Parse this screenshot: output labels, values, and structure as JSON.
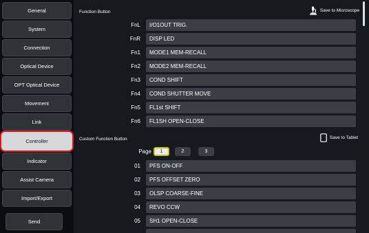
{
  "sidebar": {
    "items": [
      {
        "label": "General"
      },
      {
        "label": "System"
      },
      {
        "label": "Connection"
      },
      {
        "label": "Optical Device"
      },
      {
        "label": "OPT Optical Device"
      },
      {
        "label": "Movement"
      },
      {
        "label": "Link"
      },
      {
        "label": "Controller",
        "selected": true
      },
      {
        "label": "Indicator"
      },
      {
        "label": "Assist Camera"
      },
      {
        "label": "Import/Export"
      }
    ],
    "send_label": "Send"
  },
  "function_button": {
    "title": "Function Button",
    "save_label": "Save to Microscope",
    "save_icon": "microscope-icon",
    "rows": [
      {
        "key": "FnL",
        "value": "I/O1OUT TRIG."
      },
      {
        "key": "FnR",
        "value": "DISP LED"
      },
      {
        "key": "Fn1",
        "value": "MODE1 MEM-RECALL"
      },
      {
        "key": "Fn2",
        "value": "MODE2 MEM-RECALL"
      },
      {
        "key": "Fn3",
        "value": "COND SHIFT"
      },
      {
        "key": "Fn4",
        "value": "COND SHUTTER MOVE"
      },
      {
        "key": "Fn5",
        "value": "FL1st SHIFT"
      },
      {
        "key": "Fn6",
        "value": "FL1SH OPEN-CLOSE"
      }
    ]
  },
  "custom_function_button": {
    "title": "Custom Function Button",
    "save_label": "Save to Tablet",
    "save_icon": "tablet-icon",
    "page_label": "Page",
    "pages": [
      "1",
      "2",
      "3"
    ],
    "active_page": "1",
    "rows": [
      {
        "key": "01",
        "value": "PFS ON-OFF"
      },
      {
        "key": "02",
        "value": "PFS OFFSET ZERO"
      },
      {
        "key": "03",
        "value": "OLSP COARSE-FINE"
      },
      {
        "key": "04",
        "value": "REVO CCW"
      },
      {
        "key": "05",
        "value": "SH1 OPEN-CLOSE"
      }
    ]
  },
  "colors": {
    "selected_outline": "#e3141b",
    "active_page_border": "#c9c112",
    "field_bg": "#3b3f45"
  }
}
